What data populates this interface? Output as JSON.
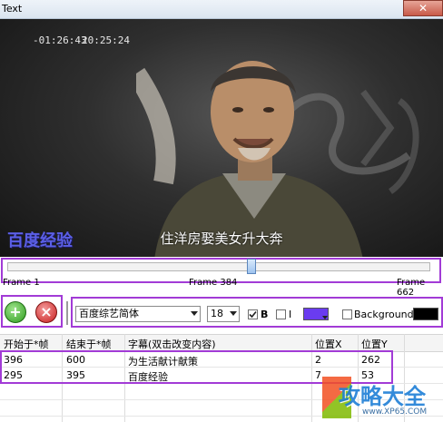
{
  "window": {
    "title": "Text",
    "close_label": "✕"
  },
  "video": {
    "timecode_left": "-01:26:43",
    "timecode_right": "20:25:24",
    "subtitle_main": "住洋房娶美女升大奔",
    "subtitle_alt": "百度经验"
  },
  "seek": {
    "start_label": "Frame 1",
    "current_label": "Frame 384",
    "end_label": "Frame 662",
    "position_fraction": 0.58
  },
  "toolbar": {
    "add_icon": "plus-icon",
    "delete_icon": "x-icon",
    "font_name": "百度综艺简体",
    "font_size": "18",
    "bold_label": "B",
    "bold_checked": true,
    "italic_label": "I",
    "italic_checked": false,
    "text_color": "#6a3cf0",
    "background_label": "Background:",
    "background_checked": false,
    "background_color": "#000000"
  },
  "table": {
    "headers": [
      "开始于*帧",
      "结束于*帧",
      "字幕(双击改变内容)",
      "位置X",
      "位置Y"
    ],
    "rows": [
      [
        "396",
        "600",
        "为生活献计献策",
        "2",
        "262"
      ],
      [
        "295",
        "395",
        "百度经验",
        "7",
        "53"
      ]
    ]
  },
  "watermark": {
    "text": "攻略大全",
    "url": "www.XP65.COM"
  },
  "colors": {
    "highlight": "#a23bd6"
  }
}
